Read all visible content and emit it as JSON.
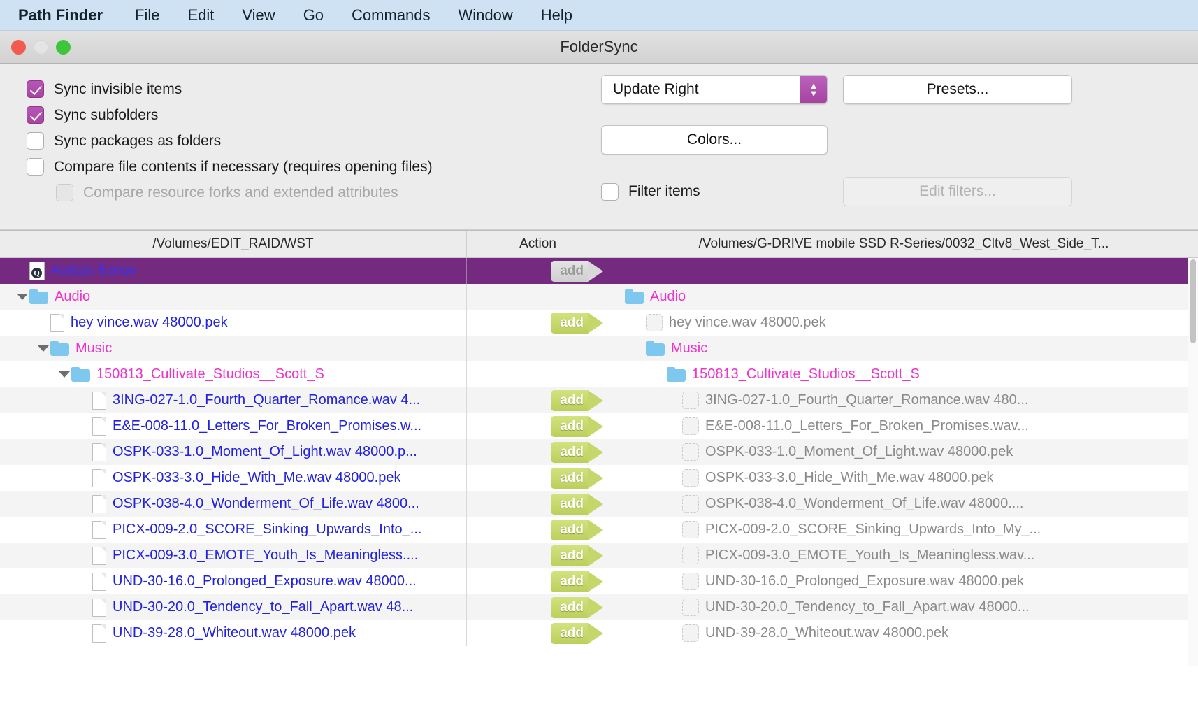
{
  "menubar": {
    "items": [
      {
        "label": "Path Finder",
        "app": true
      },
      {
        "label": "File"
      },
      {
        "label": "Edit"
      },
      {
        "label": "View"
      },
      {
        "label": "Go"
      },
      {
        "label": "Commands"
      },
      {
        "label": "Window"
      },
      {
        "label": "Help"
      }
    ]
  },
  "window": {
    "title": "FolderSync",
    "accent_purple": "#a6419f",
    "selection_purple": "#742b7f",
    "badge_green": "#c6d66b",
    "menubar_blue": "#cfe2f3"
  },
  "options": {
    "checkboxes": [
      {
        "label": "Sync invisible items",
        "checked": true,
        "disabled": false
      },
      {
        "label": "Sync subfolders",
        "checked": true,
        "disabled": false
      },
      {
        "label": "Sync packages as folders",
        "checked": false,
        "disabled": false
      },
      {
        "label": "Compare file contents if necessary (requires opening files)",
        "checked": false,
        "disabled": false
      },
      {
        "label": "Compare resource forks and extended attributes",
        "checked": false,
        "disabled": true
      }
    ],
    "mode_popup": {
      "value": "Update Right"
    },
    "presets_button": "Presets...",
    "colors_button": "Colors...",
    "filter_items": {
      "label": "Filter items",
      "checked": false
    },
    "edit_filters_button": "Edit filters..."
  },
  "table": {
    "headers": {
      "left": "/Volumes/EDIT_RAID/WST",
      "action": "Action",
      "right": "/Volumes/G-DRIVE mobile SSD R-Series/0032_Cltv8_West_Side_T..."
    },
    "rows": [
      {
        "selected": true,
        "alt": false,
        "left": {
          "name": "Aerials-5.mov",
          "kind": "movie",
          "indent": 1,
          "disclosure": "none"
        },
        "action": {
          "label": "add",
          "style": "gray"
        },
        "right": {
          "name": "",
          "kind": "none",
          "indent": 1
        }
      },
      {
        "selected": false,
        "alt": true,
        "left": {
          "name": "Audio",
          "kind": "folder",
          "indent": 1,
          "disclosure": "open"
        },
        "action": {
          "label": "",
          "style": "none"
        },
        "right": {
          "name": "Audio",
          "kind": "folder",
          "indent": 1
        }
      },
      {
        "selected": false,
        "alt": false,
        "left": {
          "name": "hey vince.wav 48000.pek",
          "kind": "file",
          "indent": 2,
          "disclosure": "none"
        },
        "action": {
          "label": "add",
          "style": "green"
        },
        "right": {
          "name": "hey vince.wav 48000.pek",
          "kind": "ghost",
          "indent": 2
        }
      },
      {
        "selected": false,
        "alt": true,
        "left": {
          "name": "Music",
          "kind": "folder",
          "indent": 2,
          "disclosure": "open"
        },
        "action": {
          "label": "",
          "style": "none"
        },
        "right": {
          "name": "Music",
          "kind": "folder",
          "indent": 2
        }
      },
      {
        "selected": false,
        "alt": false,
        "left": {
          "name": "150813_Cultivate_Studios__Scott_S",
          "kind": "folder",
          "indent": 3,
          "disclosure": "open"
        },
        "action": {
          "label": "",
          "style": "none"
        },
        "right": {
          "name": "150813_Cultivate_Studios__Scott_S",
          "kind": "folder",
          "indent": 3
        }
      },
      {
        "selected": false,
        "alt": true,
        "left": {
          "name": "3ING-027-1.0_Fourth_Quarter_Romance.wav 4...",
          "kind": "file",
          "indent": 4,
          "disclosure": "none"
        },
        "action": {
          "label": "add",
          "style": "green"
        },
        "right": {
          "name": "3ING-027-1.0_Fourth_Quarter_Romance.wav 480...",
          "kind": "ghost",
          "indent": 4
        }
      },
      {
        "selected": false,
        "alt": false,
        "left": {
          "name": "E&E-008-11.0_Letters_For_Broken_Promises.w...",
          "kind": "file",
          "indent": 4,
          "disclosure": "none"
        },
        "action": {
          "label": "add",
          "style": "green"
        },
        "right": {
          "name": "E&E-008-11.0_Letters_For_Broken_Promises.wav...",
          "kind": "ghost",
          "indent": 4
        }
      },
      {
        "selected": false,
        "alt": true,
        "left": {
          "name": "OSPK-033-1.0_Moment_Of_Light.wav 48000.p...",
          "kind": "file",
          "indent": 4,
          "disclosure": "none"
        },
        "action": {
          "label": "add",
          "style": "green"
        },
        "right": {
          "name": "OSPK-033-1.0_Moment_Of_Light.wav 48000.pek",
          "kind": "ghost",
          "indent": 4
        }
      },
      {
        "selected": false,
        "alt": false,
        "left": {
          "name": "OSPK-033-3.0_Hide_With_Me.wav 48000.pek",
          "kind": "file",
          "indent": 4,
          "disclosure": "none"
        },
        "action": {
          "label": "add",
          "style": "green"
        },
        "right": {
          "name": "OSPK-033-3.0_Hide_With_Me.wav 48000.pek",
          "kind": "ghost",
          "indent": 4
        }
      },
      {
        "selected": false,
        "alt": true,
        "left": {
          "name": "OSPK-038-4.0_Wonderment_Of_Life.wav 4800...",
          "kind": "file",
          "indent": 4,
          "disclosure": "none"
        },
        "action": {
          "label": "add",
          "style": "green"
        },
        "right": {
          "name": "OSPK-038-4.0_Wonderment_Of_Life.wav 48000....",
          "kind": "ghost",
          "indent": 4
        }
      },
      {
        "selected": false,
        "alt": false,
        "left": {
          "name": "PICX-009-2.0_SCORE_Sinking_Upwards_Into_...",
          "kind": "file",
          "indent": 4,
          "disclosure": "none"
        },
        "action": {
          "label": "add",
          "style": "green"
        },
        "right": {
          "name": "PICX-009-2.0_SCORE_Sinking_Upwards_Into_My_...",
          "kind": "ghost",
          "indent": 4
        }
      },
      {
        "selected": false,
        "alt": true,
        "left": {
          "name": "PICX-009-3.0_EMOTE_Youth_Is_Meaningless....",
          "kind": "file",
          "indent": 4,
          "disclosure": "none"
        },
        "action": {
          "label": "add",
          "style": "green"
        },
        "right": {
          "name": "PICX-009-3.0_EMOTE_Youth_Is_Meaningless.wav...",
          "kind": "ghost",
          "indent": 4
        }
      },
      {
        "selected": false,
        "alt": false,
        "left": {
          "name": "UND-30-16.0_Prolonged_Exposure.wav 48000...",
          "kind": "file",
          "indent": 4,
          "disclosure": "none"
        },
        "action": {
          "label": "add",
          "style": "green"
        },
        "right": {
          "name": "UND-30-16.0_Prolonged_Exposure.wav 48000.pek",
          "kind": "ghost",
          "indent": 4
        }
      },
      {
        "selected": false,
        "alt": true,
        "left": {
          "name": "UND-30-20.0_Tendency_to_Fall_Apart.wav 48...",
          "kind": "file",
          "indent": 4,
          "disclosure": "none"
        },
        "action": {
          "label": "add",
          "style": "green"
        },
        "right": {
          "name": "UND-30-20.0_Tendency_to_Fall_Apart.wav 48000...",
          "kind": "ghost",
          "indent": 4
        }
      },
      {
        "selected": false,
        "alt": false,
        "left": {
          "name": "UND-39-28.0_Whiteout.wav 48000.pek",
          "kind": "file",
          "indent": 4,
          "disclosure": "none"
        },
        "action": {
          "label": "add",
          "style": "green"
        },
        "right": {
          "name": "UND-39-28.0_Whiteout.wav 48000.pek",
          "kind": "ghost",
          "indent": 4
        }
      }
    ]
  }
}
